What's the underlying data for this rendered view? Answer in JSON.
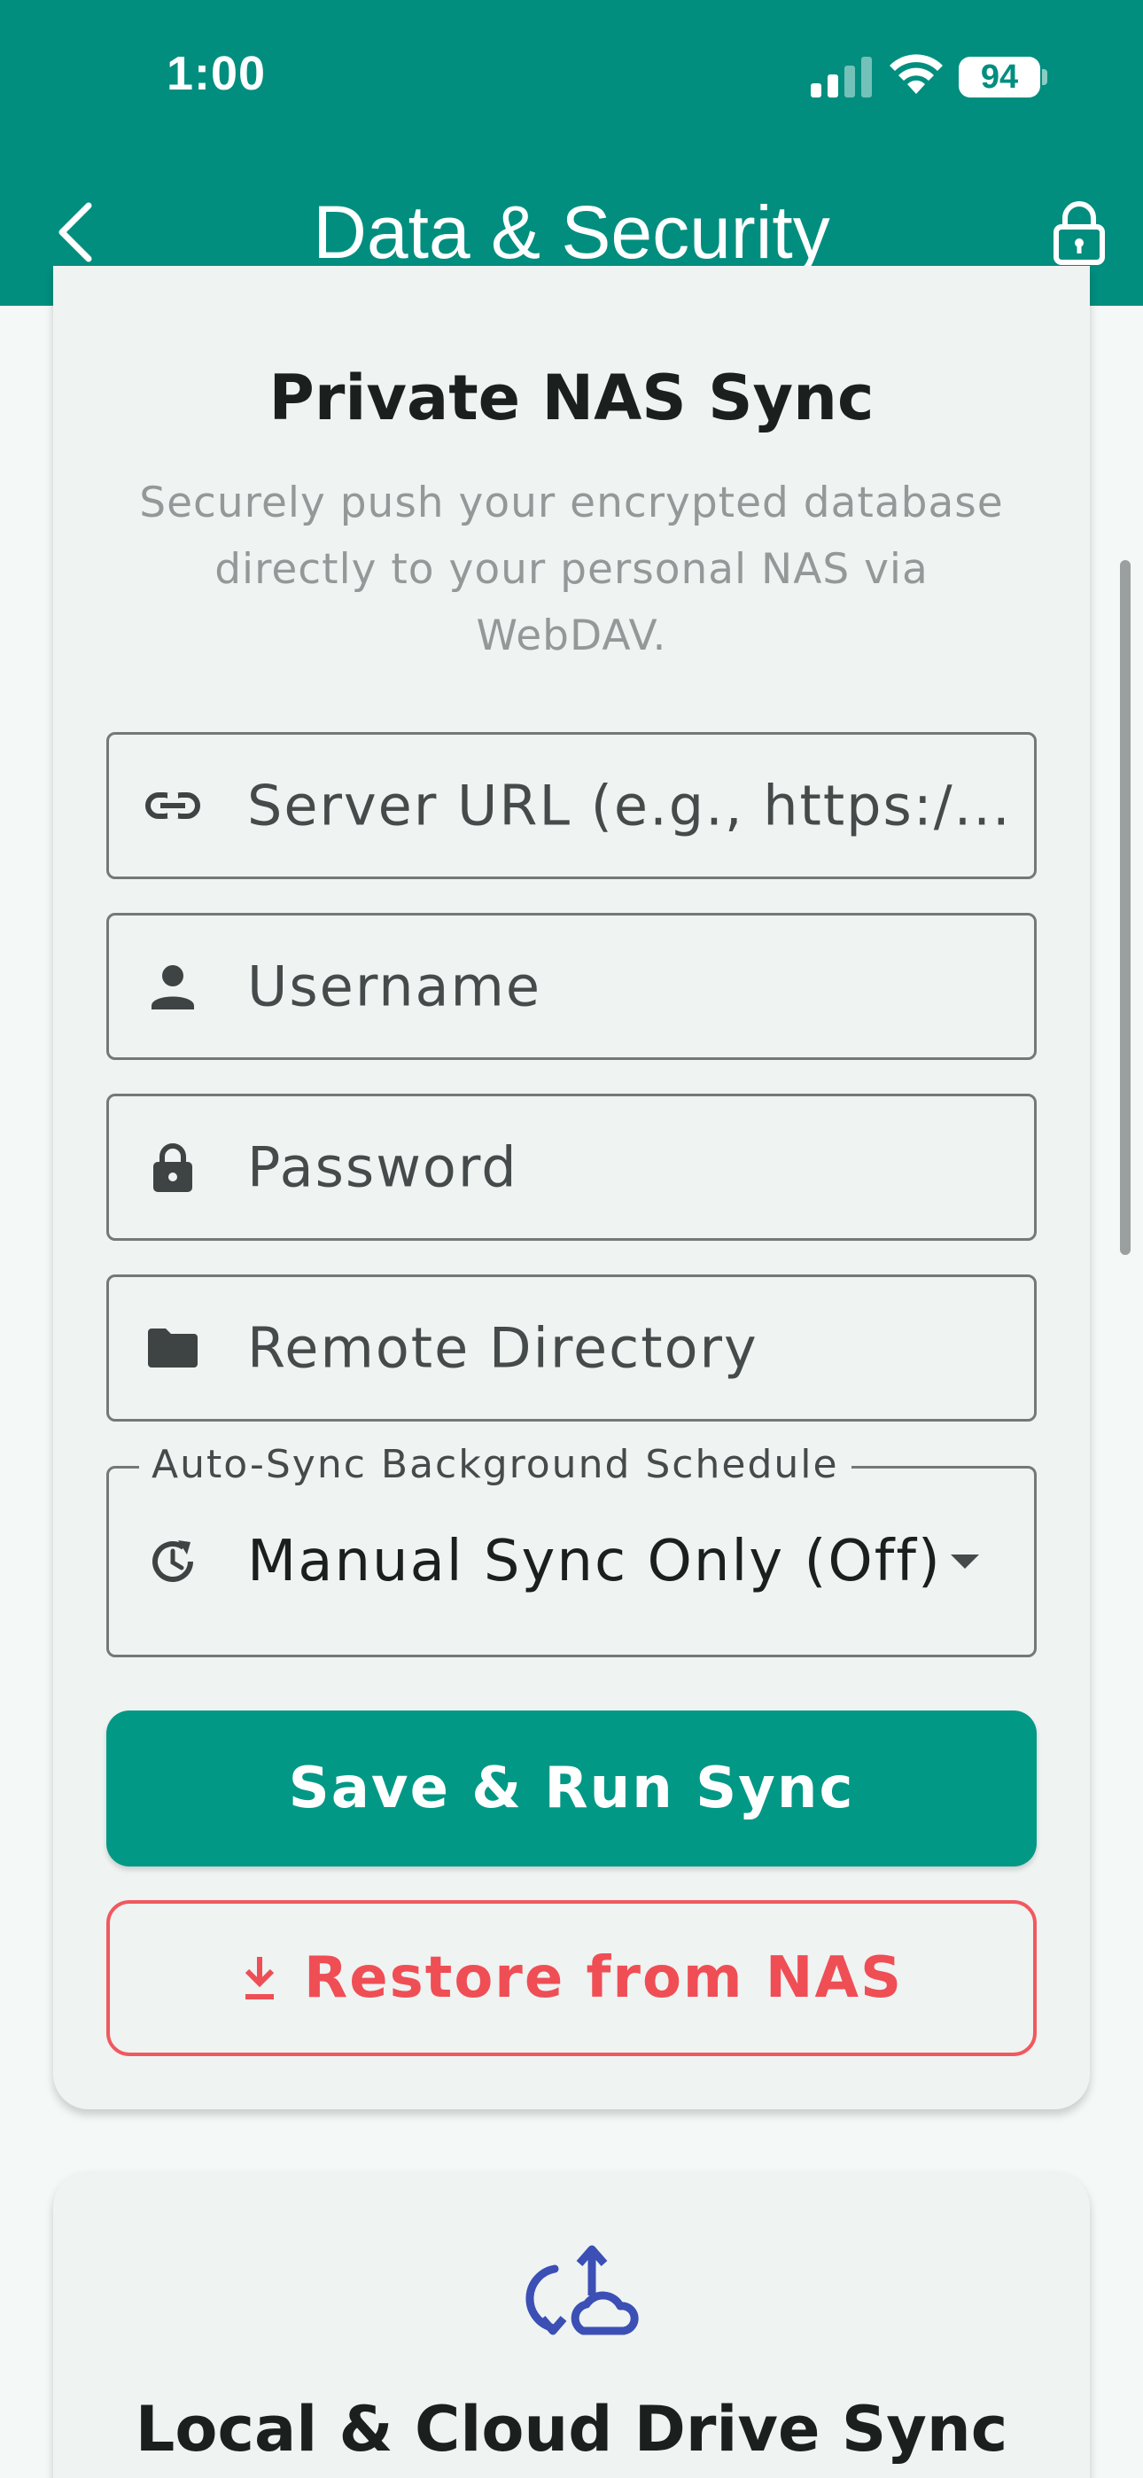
{
  "status_bar": {
    "time": "1:00",
    "battery": "94"
  },
  "app_bar": {
    "title": "Data & Security",
    "back_icon": "chevron-left-icon",
    "action_icon": "lock-icon"
  },
  "nas_card": {
    "title": "Private NAS Sync",
    "description": "Securely push your encrypted database directly to your personal NAS via WebDAV.",
    "fields": {
      "server_url_placeholder": "Server URL (e.g., https:/...",
      "username_placeholder": "Username",
      "password_placeholder": "Password",
      "directory_placeholder": "Remote Directory"
    },
    "schedule": {
      "label": "Auto-Sync Background Schedule",
      "selected": "Manual Sync Only (Off)"
    },
    "save_button": "Save & Run Sync",
    "restore_button": "Restore from NAS"
  },
  "cloud_card": {
    "title": "Local & Cloud Drive Sync",
    "icon": "cloud-sync-icon"
  },
  "colors": {
    "primary": "#018e7f",
    "button": "#029886",
    "danger": "#ef4e55",
    "accent_icon": "#3b4fb5"
  }
}
